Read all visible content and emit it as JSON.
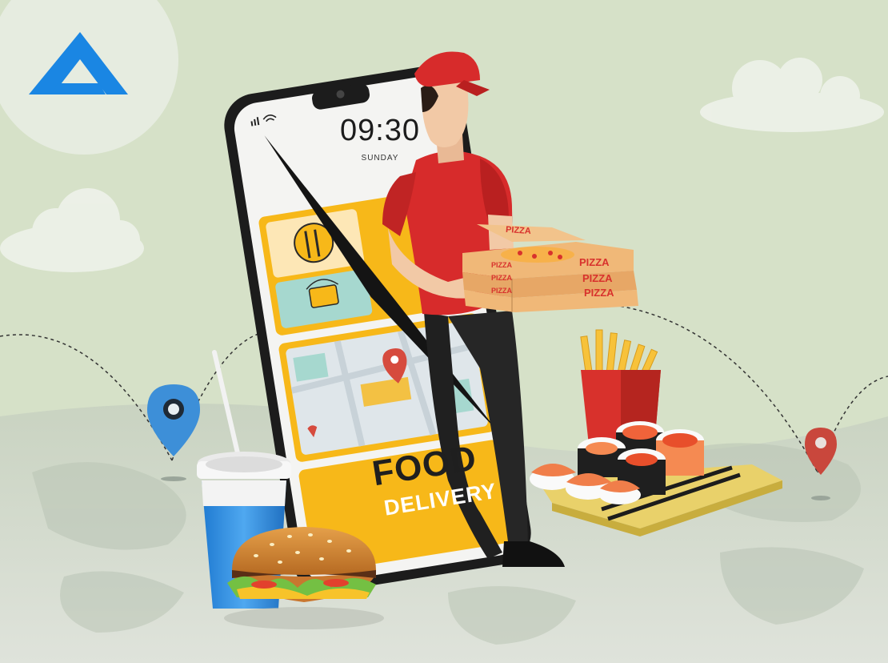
{
  "phone": {
    "time": "09:30",
    "day": "SUNDAY"
  },
  "banner": {
    "line1": "FOOD",
    "line2": "DELIVERY"
  },
  "pizza_box": {
    "label": "PIZZA"
  },
  "colors": {
    "background": "#d6e1c8",
    "brand_blue": "#1a86e3",
    "uniform_red": "#d72b2b",
    "banner_yellow": "#f7b819",
    "pin_red": "#d64b3e"
  },
  "icons": [
    "logo",
    "signal-icon",
    "wifi-icon",
    "plate-icon",
    "basket-icon",
    "map-pin-icon"
  ]
}
